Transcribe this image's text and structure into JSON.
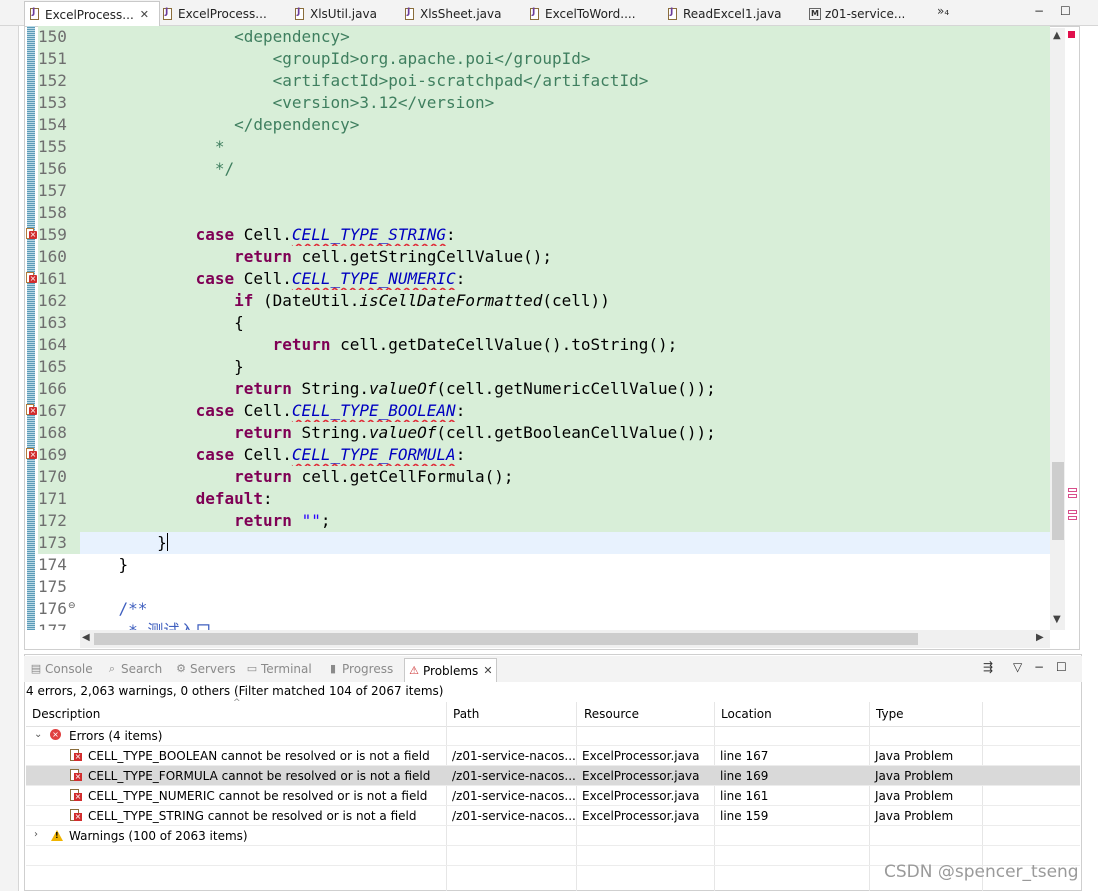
{
  "editor_tabs": [
    {
      "label": "ExcelProcess...",
      "icon": "java-file-icon",
      "close": "✕"
    },
    {
      "label": "ExcelProcess...",
      "icon": "java-file-icon"
    },
    {
      "label": "XlsUtil.java",
      "icon": "java-file-icon"
    },
    {
      "label": "XlsSheet.java",
      "icon": "java-file-icon"
    },
    {
      "label": "ExcelToWord....",
      "icon": "java-file-icon"
    },
    {
      "label": "ReadExcel1.java",
      "icon": "java-file-icon"
    },
    {
      "label": "z01-service...",
      "icon": "maven-pom-icon"
    }
  ],
  "tab_overflow": "»₄",
  "window_buttons": {
    "minimize": "−",
    "maximize": "☐"
  },
  "code_lines": [
    {
      "num": "150",
      "text": "                <dependency>"
    },
    {
      "num": "151",
      "text": "                    <groupId>org.apache.poi</groupId>"
    },
    {
      "num": "152",
      "text": "                    <artifactId>poi-scratchpad</artifactId>"
    },
    {
      "num": "153",
      "text": "                    <version>3.12</version>"
    },
    {
      "num": "154",
      "text": "                </dependency>"
    },
    {
      "num": "155",
      "text": "              *"
    },
    {
      "num": "156",
      "text": "              */"
    },
    {
      "num": "157",
      "text": ""
    },
    {
      "num": "158",
      "text": ""
    },
    {
      "num": "159",
      "kw": "case",
      "pre": "            ",
      "cls": " Cell.",
      "field": "CELL_TYPE_STRING",
      "post": ":"
    },
    {
      "num": "160",
      "text": "                return cell.getStringCellValue();"
    },
    {
      "num": "161",
      "kw": "case",
      "pre": "            ",
      "cls": " Cell.",
      "field": "CELL_TYPE_NUMERIC",
      "post": ":"
    },
    {
      "num": "162",
      "text": "                if (DateUtil.isCellDateFormatted(cell))"
    },
    {
      "num": "163",
      "text": "                {"
    },
    {
      "num": "164",
      "text": "                    return cell.getDateCellValue().toString();"
    },
    {
      "num": "165",
      "text": "                }"
    },
    {
      "num": "166",
      "text": "                return String.valueOf(cell.getNumericCellValue());"
    },
    {
      "num": "167",
      "kw": "case",
      "pre": "            ",
      "cls": " Cell.",
      "field": "CELL_TYPE_BOOLEAN",
      "post": ":"
    },
    {
      "num": "168",
      "text": "                return String.valueOf(cell.getBooleanCellValue());"
    },
    {
      "num": "169",
      "kw": "case",
      "pre": "            ",
      "cls": " Cell.",
      "field": "CELL_TYPE_FORMULA",
      "post": ":"
    },
    {
      "num": "170",
      "text": "                return cell.getCellFormula();"
    },
    {
      "num": "171",
      "text": "            default:"
    },
    {
      "num": "172",
      "text": "                return \"\";"
    },
    {
      "num": "173",
      "text": "        }"
    },
    {
      "num": "174",
      "text": "    }"
    },
    {
      "num": "175",
      "text": ""
    },
    {
      "num": "176",
      "text": "    /**"
    },
    {
      "num": "177",
      "text": "     * 测试入口"
    }
  ],
  "panel_tabs": [
    {
      "label": "Console",
      "icon": "console-icon"
    },
    {
      "label": "Search",
      "icon": "search-icon"
    },
    {
      "label": "Servers",
      "icon": "servers-icon"
    },
    {
      "label": "Terminal",
      "icon": "terminal-icon"
    },
    {
      "label": "Progress",
      "icon": "progress-icon"
    },
    {
      "label": "Problems",
      "icon": "problems-icon",
      "close": "✕"
    }
  ],
  "problems": {
    "summary": "4 errors, 2,063 warnings, 0 others (Filter matched 104 of 2067 items)",
    "columns": [
      "Description",
      "Path",
      "Resource",
      "Location",
      "Type"
    ],
    "errors_group": "Errors (4 items)",
    "warnings_group": "Warnings (100 of 2063 items)",
    "rows": [
      {
        "description": "CELL_TYPE_BOOLEAN cannot be resolved or is not a field",
        "path": "/z01-service-nacos...",
        "resource": "ExcelProcessor.java",
        "location": "line 167",
        "type": "Java Problem"
      },
      {
        "description": "CELL_TYPE_FORMULA cannot be resolved or is not a field",
        "path": "/z01-service-nacos...",
        "resource": "ExcelProcessor.java",
        "location": "line 169",
        "type": "Java Problem"
      },
      {
        "description": "CELL_TYPE_NUMERIC cannot be resolved or is not a field",
        "path": "/z01-service-nacos...",
        "resource": "ExcelProcessor.java",
        "location": "line 161",
        "type": "Java Problem"
      },
      {
        "description": "CELL_TYPE_STRING cannot be resolved or is not a field",
        "path": "/z01-service-nacos...",
        "resource": "ExcelProcessor.java",
        "location": "line 159",
        "type": "Java Problem"
      }
    ]
  },
  "watermark": "CSDN @spencer_tseng",
  "colors": {
    "editor_bg": "#d8eed8",
    "current_line": "#e8f2fe",
    "keyword": "#7f0055",
    "comment": "#3f7f5f",
    "javadoc": "#3f5fbf",
    "error": "#e0303b"
  }
}
